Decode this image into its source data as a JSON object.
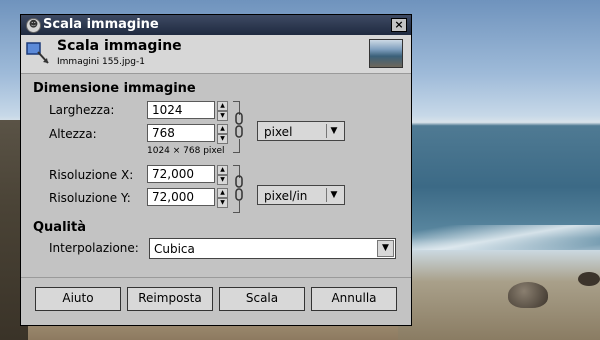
{
  "window": {
    "title": "Scala immagine"
  },
  "header": {
    "title": "Scala immagine",
    "subtitle": "Immagini 155.jpg-1"
  },
  "image_size": {
    "section_title": "Dimensione immagine",
    "width_label": "Larghezza:",
    "width_value": "1024",
    "height_label": "Altezza:",
    "height_value": "768",
    "size_note": "1024 × 768 pixel",
    "unit": "pixel",
    "res_x_label": "Risoluzione X:",
    "res_x_value": "72,000",
    "res_y_label": "Risoluzione Y:",
    "res_y_value": "72,000",
    "res_unit": "pixel/in"
  },
  "quality": {
    "section_title": "Qualità",
    "interp_label": "Interpolazione:",
    "interp_value": "Cubica"
  },
  "buttons": {
    "help": "Aiuto",
    "reset": "Reimposta",
    "scale": "Scala",
    "cancel": "Annulla"
  }
}
